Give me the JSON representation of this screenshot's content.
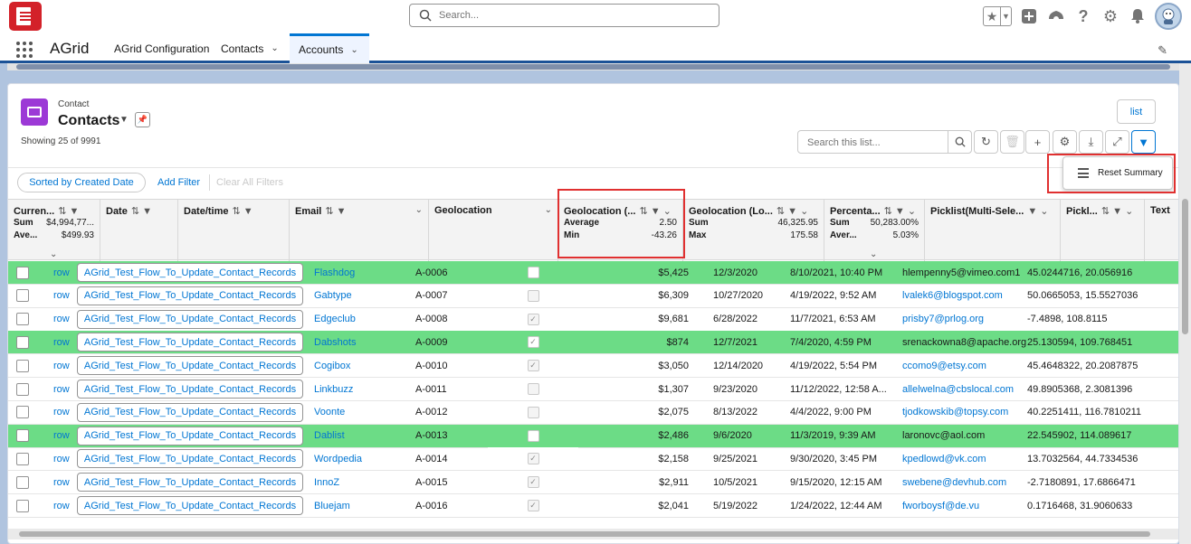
{
  "header": {
    "search_placeholder": "Search...",
    "icons": [
      "star-icon",
      "chevron-down-icon",
      "add-icon",
      "trailhead-icon",
      "help-icon",
      "gear-icon",
      "bell-icon",
      "avatar-icon"
    ]
  },
  "nav": {
    "app_name": "AGrid",
    "tabs": [
      {
        "label": "AGrid Configuration"
      },
      {
        "label": "Contacts"
      },
      {
        "label": "Accounts",
        "active": true
      }
    ]
  },
  "card": {
    "object_label": "Contact",
    "title": "Contacts",
    "showing": "Showing 25 of 9991",
    "list_button": "list",
    "search_placeholder": "Search this list...",
    "sorted_by": "Sorted by Created Date",
    "add_filter": "Add Filter",
    "clear_filters": "Clear All Filters",
    "reset_summary": "Reset Summary"
  },
  "columns": [
    {
      "title": "Curren...",
      "summary": [
        [
          "Sum",
          "$4,994,77..."
        ],
        [
          "Ave...",
          "$499.93"
        ]
      ]
    },
    {
      "title": "Date",
      "summary": []
    },
    {
      "title": "Date/time",
      "summary": []
    },
    {
      "title": "Email",
      "summary": []
    },
    {
      "title": "Geolocation",
      "summary": []
    },
    {
      "title": "Geolocation (...",
      "summary": [
        [
          "Average",
          "2.50"
        ],
        [
          "Min",
          "-43.26"
        ]
      ]
    },
    {
      "title": "Geolocation (Lo...",
      "summary": [
        [
          "Sum",
          "46,325.95"
        ],
        [
          "Max",
          "175.58"
        ]
      ]
    },
    {
      "title": "Percenta...",
      "summary": [
        [
          "Sum",
          "50,283.00%"
        ],
        [
          "Aver...",
          "5.03%"
        ]
      ]
    },
    {
      "title": "Picklist(Multi-Sele...",
      "summary": []
    },
    {
      "title": "Pickl...",
      "summary": []
    },
    {
      "title": "Text",
      "summary": []
    }
  ],
  "rows": [
    {
      "row": "row",
      "flow": "AGrid_Test_Flow_To_Update_Contact_Records",
      "name": "Flashdog",
      "id": "A-0006",
      "checked": false,
      "amount": "$5,425",
      "date": "12/3/2020",
      "datetime": "8/10/2021, 10:40 PM",
      "email": "hlempenny5@vimeo.com1",
      "geo": "45.0244716, 20.056916",
      "highlight": true
    },
    {
      "row": "row",
      "flow": "AGrid_Test_Flow_To_Update_Contact_Records",
      "name": "Gabtype",
      "id": "A-0007",
      "checked": false,
      "amount": "$6,309",
      "date": "10/27/2020",
      "datetime": "4/19/2022, 9:52 AM",
      "email": "lvalek6@blogspot.com",
      "geo": "50.0665053, 15.5527036",
      "highlight": false
    },
    {
      "row": "row",
      "flow": "AGrid_Test_Flow_To_Update_Contact_Records",
      "name": "Edgeclub",
      "id": "A-0008",
      "checked": true,
      "amount": "$9,681",
      "date": "6/28/2022",
      "datetime": "11/7/2021, 6:53 AM",
      "email": "prisby7@prlog.org",
      "geo": "-7.4898, 108.8115",
      "highlight": false
    },
    {
      "row": "row",
      "flow": "AGrid_Test_Flow_To_Update_Contact_Records",
      "name": "Dabshots",
      "id": "A-0009",
      "checked": true,
      "amount": "$874",
      "date": "12/7/2021",
      "datetime": "7/4/2020, 4:59 PM",
      "email": "srenackowna8@apache.org",
      "geo": "25.130594, 109.768451",
      "highlight": true
    },
    {
      "row": "row",
      "flow": "AGrid_Test_Flow_To_Update_Contact_Records",
      "name": "Cogibox",
      "id": "A-0010",
      "checked": true,
      "amount": "$3,050",
      "date": "12/14/2020",
      "datetime": "4/19/2022, 5:54 PM",
      "email": "ccomo9@etsy.com",
      "geo": "45.4648322, 20.2087875",
      "highlight": false
    },
    {
      "row": "row",
      "flow": "AGrid_Test_Flow_To_Update_Contact_Records",
      "name": "Linkbuzz",
      "id": "A-0011",
      "checked": false,
      "amount": "$1,307",
      "date": "9/23/2020",
      "datetime": "11/12/2022, 12:58 A...",
      "email": "allelwelna@cbslocal.com",
      "geo": "49.8905368, 2.3081396",
      "highlight": false
    },
    {
      "row": "row",
      "flow": "AGrid_Test_Flow_To_Update_Contact_Records",
      "name": "Voonte",
      "id": "A-0012",
      "checked": false,
      "amount": "$2,075",
      "date": "8/13/2022",
      "datetime": "4/4/2022, 9:00 PM",
      "email": "tjodkowskib@topsy.com",
      "geo": "40.2251411, 116.7810211",
      "highlight": false
    },
    {
      "row": "row",
      "flow": "AGrid_Test_Flow_To_Update_Contact_Records",
      "name": "Dablist",
      "id": "A-0013",
      "checked": false,
      "amount": "$2,486",
      "date": "9/6/2020",
      "datetime": "11/3/2019, 9:39 AM",
      "email": "laronovc@aol.com",
      "geo": "22.545902, 114.089617",
      "highlight": true
    },
    {
      "row": "row",
      "flow": "AGrid_Test_Flow_To_Update_Contact_Records",
      "name": "Wordpedia",
      "id": "A-0014",
      "checked": true,
      "amount": "$2,158",
      "date": "9/25/2021",
      "datetime": "9/30/2020, 3:45 PM",
      "email": "kpedlowd@vk.com",
      "geo": "13.7032564, 44.7334536",
      "highlight": false
    },
    {
      "row": "row",
      "flow": "AGrid_Test_Flow_To_Update_Contact_Records",
      "name": "InnoZ",
      "id": "A-0015",
      "checked": true,
      "amount": "$2,911",
      "date": "10/5/2021",
      "datetime": "9/15/2020, 12:15 AM",
      "email": "swebene@devhub.com",
      "geo": "-2.7180891, 17.6866471",
      "highlight": false
    },
    {
      "row": "row",
      "flow": "AGrid_Test_Flow_To_Update_Contact_Records",
      "name": "Bluejam",
      "id": "A-0016",
      "checked": true,
      "amount": "$2,041",
      "date": "5/19/2022",
      "datetime": "1/24/2022, 12:44 AM",
      "email": "fworboysf@de.vu",
      "geo": "0.1716468, 31.9060633",
      "highlight": false
    }
  ],
  "colors": {
    "highlight": "#6cdc86",
    "brand": "#0176d3",
    "accent_red": "#e03030"
  }
}
